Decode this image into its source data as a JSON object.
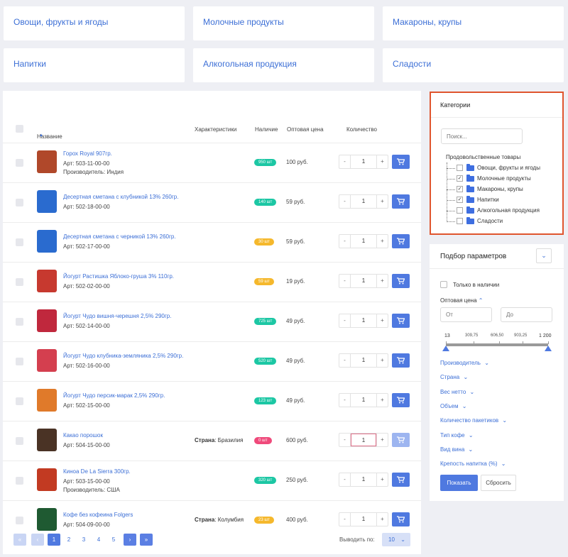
{
  "categories": [
    "Овощи, фрукты и ягоды",
    "Молочные продукты",
    "Макароны, крупы",
    "Напитки",
    "Алкогольная продукция",
    "Сладости"
  ],
  "table": {
    "headers": {
      "name": "Название",
      "sort_arrow": "▲",
      "chars": "Характеристики",
      "stock": "Наличие",
      "price": "Оптовая цена",
      "qty": "Количество"
    },
    "rows": [
      {
        "name": "Горох Royal 907гр.",
        "art": "Арт: 503-11-00-00",
        "maker": "Производитель: Индия",
        "char_label": "",
        "char_value": "",
        "stock": "950 шт",
        "stock_color": "#1cc7a4",
        "price": "100 руб.",
        "qty": "1",
        "thumb_color": "#b0482a"
      },
      {
        "name": "Десертная сметана с клубникой 13% 260гр.",
        "art": "Арт: 502-18-00-00",
        "maker": "",
        "char_label": "",
        "char_value": "",
        "stock": "140 шт",
        "stock_color": "#1cc7a4",
        "price": "59 руб.",
        "qty": "1",
        "thumb_color": "#2a6bcf"
      },
      {
        "name": "Десертная сметана с черникой 13% 260гр.",
        "art": "Арт: 502-17-00-00",
        "maker": "",
        "char_label": "",
        "char_value": "",
        "stock": "30 шт",
        "stock_color": "#f5b82c",
        "price": "59 руб.",
        "qty": "1",
        "thumb_color": "#2a6bcf"
      },
      {
        "name": "Йогурт Растишка Яблоко-груша 3% 110гр.",
        "art": "Арт: 502-02-00-00",
        "maker": "",
        "char_label": "",
        "char_value": "",
        "stock": "59 шт",
        "stock_color": "#f5b82c",
        "price": "19 руб.",
        "qty": "1",
        "thumb_color": "#c7392f"
      },
      {
        "name": "Йогурт Чудо вишня-черешня 2,5% 290гр.",
        "art": "Арт: 502-14-00-00",
        "maker": "",
        "char_label": "",
        "char_value": "",
        "stock": "725 шт",
        "stock_color": "#1cc7a4",
        "price": "49 руб.",
        "qty": "1",
        "thumb_color": "#c0283d"
      },
      {
        "name": "Йогурт Чудо клубника-земляника 2,5% 290гр.",
        "art": "Арт: 502-16-00-00",
        "maker": "",
        "char_label": "",
        "char_value": "",
        "stock": "520 шт",
        "stock_color": "#1cc7a4",
        "price": "49 руб.",
        "qty": "1",
        "thumb_color": "#d43f4f"
      },
      {
        "name": "Йогурт Чудо персик-марак 2,5% 290гр.",
        "art": "Арт: 502-15-00-00",
        "maker": "",
        "char_label": "",
        "char_value": "",
        "stock": "123 шт",
        "stock_color": "#1cc7a4",
        "price": "49 руб.",
        "qty": "1",
        "thumb_color": "#e07a2a"
      },
      {
        "name": "Какао порошок",
        "art": "Арт: 504-15-00-00",
        "maker": "",
        "char_label": "Страна",
        "char_value": ": Бразилия",
        "stock": "0 шт",
        "stock_color": "#ef4a7b",
        "price": "600 руб.",
        "qty": "1",
        "thumb_color": "#4a3325"
      },
      {
        "name": "Киноа De La Sierra 300гр.",
        "art": "Арт: 503-15-00-00",
        "maker": "Производитель: США",
        "char_label": "",
        "char_value": "",
        "stock": "320 шт",
        "stock_color": "#1cc7a4",
        "price": "250 руб.",
        "qty": "1",
        "thumb_color": "#c23a22"
      },
      {
        "name": "Кофе без кофеина Folgers",
        "art": "Арт: 504-09-00-00",
        "maker": "",
        "char_label": "Страна",
        "char_value": ": Колумбия",
        "stock": "23 шт",
        "stock_color": "#f5b82c",
        "price": "400 руб.",
        "qty": "1",
        "thumb_color": "#1f5a32"
      }
    ]
  },
  "pagination": {
    "first": "«",
    "prev": "‹",
    "pages": [
      "1",
      "2",
      "3",
      "4",
      "5"
    ],
    "current": "1",
    "next": "›",
    "last": "»",
    "per_page_label": "Выводить по:",
    "per_page_value": "10"
  },
  "category_tree": {
    "title": "Категории",
    "search_placeholder": "Поиск...",
    "root": "Продовольственные товары",
    "items": [
      {
        "label": "Овощи, фрукты и ягоды",
        "checked": false
      },
      {
        "label": "Молочные продукты",
        "checked": true
      },
      {
        "label": "Макароны, крупы",
        "checked": true
      },
      {
        "label": "Напитки",
        "checked": true
      },
      {
        "label": "Алкогольная продукция",
        "checked": false
      },
      {
        "label": "Сладости",
        "checked": false
      }
    ]
  },
  "filter": {
    "title": "Подбор параметров",
    "only_in_stock": "Только в наличии",
    "price_label": "Оптовая цена",
    "from_placeholder": "От",
    "to_placeholder": "До",
    "range_min": "13",
    "range_max": "1 200",
    "ticks": [
      "309,75",
      "606,50",
      "903,25"
    ],
    "facets": [
      "Производитель",
      "Страна",
      "Вес нетто",
      "Объем",
      "Количество пакетиков",
      "Тип кофе",
      "Вид вина",
      "Крепость напитка (%)"
    ],
    "show_button": "Показать",
    "reset_button": "Сбросить"
  },
  "colors": {
    "accent": "#4f79e0",
    "link": "#3c6fd6",
    "highlight_border": "#e0552e"
  }
}
